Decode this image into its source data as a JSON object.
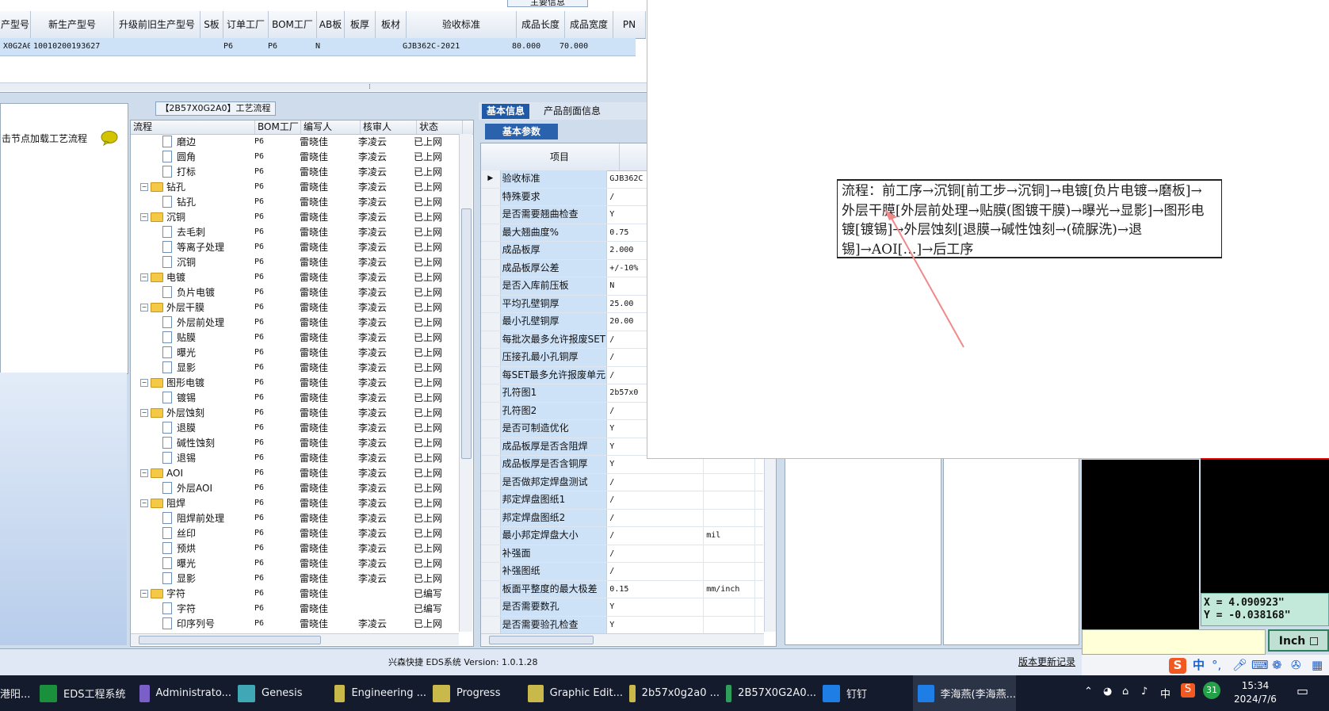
{
  "top_grid": {
    "group_caption": "主要信息",
    "columns": [
      "产型号",
      "新生产型号",
      "升级前旧生产型号",
      "S板",
      "订单工厂",
      "BOM工厂",
      "AB板",
      "板厚",
      "板材",
      "验收标准",
      "成品长度",
      "成品宽度",
      "PN"
    ],
    "row": [
      "X0G2A0",
      "10010200193627",
      "",
      "",
      "P6",
      "P6",
      "N",
      "",
      "",
      "GJB362C-2021",
      "80.000",
      "70.000",
      ""
    ]
  },
  "left_panel": {
    "hint": "击节点加载工艺流程"
  },
  "process_tree": {
    "caption": "【2B57X0G2A0】工艺流程",
    "columns": [
      "流程",
      "BOM工厂",
      "编写人",
      "核审人",
      "状态"
    ],
    "rows": [
      {
        "name": "磨边",
        "level": 2,
        "type": "doc",
        "bom": "P6",
        "writer": "雷晓佳",
        "reviewer": "李凌云",
        "status": "已上网"
      },
      {
        "name": "圆角",
        "level": 2,
        "type": "doc",
        "bom": "P6",
        "writer": "雷晓佳",
        "reviewer": "李凌云",
        "status": "已上网"
      },
      {
        "name": "打标",
        "level": 2,
        "type": "doc",
        "bom": "P6",
        "writer": "雷晓佳",
        "reviewer": "李凌云",
        "status": "已上网"
      },
      {
        "name": "钻孔",
        "level": 1,
        "type": "folder",
        "bom": "P6",
        "writer": "雷晓佳",
        "reviewer": "李凌云",
        "status": "已上网"
      },
      {
        "name": "钻孔",
        "level": 2,
        "type": "doc",
        "bom": "P6",
        "writer": "雷晓佳",
        "reviewer": "李凌云",
        "status": "已上网"
      },
      {
        "name": "沉铜",
        "level": 1,
        "type": "folder",
        "bom": "P6",
        "writer": "雷晓佳",
        "reviewer": "李凌云",
        "status": "已上网"
      },
      {
        "name": "去毛刺",
        "level": 2,
        "type": "doc",
        "bom": "P6",
        "writer": "雷晓佳",
        "reviewer": "李凌云",
        "status": "已上网"
      },
      {
        "name": "等离子处理",
        "level": 2,
        "type": "doc",
        "bom": "P6",
        "writer": "雷晓佳",
        "reviewer": "李凌云",
        "status": "已上网"
      },
      {
        "name": "沉铜",
        "level": 2,
        "type": "doc",
        "bom": "P6",
        "writer": "雷晓佳",
        "reviewer": "李凌云",
        "status": "已上网"
      },
      {
        "name": "电镀",
        "level": 1,
        "type": "folder",
        "bom": "P6",
        "writer": "雷晓佳",
        "reviewer": "李凌云",
        "status": "已上网"
      },
      {
        "name": "负片电镀",
        "level": 2,
        "type": "doc",
        "bom": "P6",
        "writer": "雷晓佳",
        "reviewer": "李凌云",
        "status": "已上网"
      },
      {
        "name": "外层干膜",
        "level": 1,
        "type": "folder",
        "bom": "P6",
        "writer": "雷晓佳",
        "reviewer": "李凌云",
        "status": "已上网"
      },
      {
        "name": "外层前处理",
        "level": 2,
        "type": "doc",
        "bom": "P6",
        "writer": "雷晓佳",
        "reviewer": "李凌云",
        "status": "已上网"
      },
      {
        "name": "贴膜",
        "level": 2,
        "type": "doc",
        "bom": "P6",
        "writer": "雷晓佳",
        "reviewer": "李凌云",
        "status": "已上网"
      },
      {
        "name": "曝光",
        "level": 2,
        "type": "doc",
        "bom": "P6",
        "writer": "雷晓佳",
        "reviewer": "李凌云",
        "status": "已上网"
      },
      {
        "name": "显影",
        "level": 2,
        "type": "doc",
        "bom": "P6",
        "writer": "雷晓佳",
        "reviewer": "李凌云",
        "status": "已上网"
      },
      {
        "name": "图形电镀",
        "level": 1,
        "type": "folder",
        "bom": "P6",
        "writer": "雷晓佳",
        "reviewer": "李凌云",
        "status": "已上网"
      },
      {
        "name": "镀锡",
        "level": 2,
        "type": "doc",
        "bom": "P6",
        "writer": "雷晓佳",
        "reviewer": "李凌云",
        "status": "已上网"
      },
      {
        "name": "外层蚀刻",
        "level": 1,
        "type": "folder",
        "bom": "P6",
        "writer": "雷晓佳",
        "reviewer": "李凌云",
        "status": "已上网"
      },
      {
        "name": "退膜",
        "level": 2,
        "type": "doc",
        "bom": "P6",
        "writer": "雷晓佳",
        "reviewer": "李凌云",
        "status": "已上网"
      },
      {
        "name": "碱性蚀刻",
        "level": 2,
        "type": "doc",
        "bom": "P6",
        "writer": "雷晓佳",
        "reviewer": "李凌云",
        "status": "已上网"
      },
      {
        "name": "退锡",
        "level": 2,
        "type": "doc",
        "bom": "P6",
        "writer": "雷晓佳",
        "reviewer": "李凌云",
        "status": "已上网"
      },
      {
        "name": "AOI",
        "level": 1,
        "type": "folder",
        "bom": "P6",
        "writer": "雷晓佳",
        "reviewer": "李凌云",
        "status": "已上网"
      },
      {
        "name": "外层AOI",
        "level": 2,
        "type": "doc",
        "bom": "P6",
        "writer": "雷晓佳",
        "reviewer": "李凌云",
        "status": "已上网"
      },
      {
        "name": "阻焊",
        "level": 1,
        "type": "folder",
        "bom": "P6",
        "writer": "雷晓佳",
        "reviewer": "李凌云",
        "status": "已上网"
      },
      {
        "name": "阻焊前处理",
        "level": 2,
        "type": "doc",
        "bom": "P6",
        "writer": "雷晓佳",
        "reviewer": "李凌云",
        "status": "已上网"
      },
      {
        "name": "丝印",
        "level": 2,
        "type": "doc",
        "bom": "P6",
        "writer": "雷晓佳",
        "reviewer": "李凌云",
        "status": "已上网"
      },
      {
        "name": "预烘",
        "level": 2,
        "type": "doc",
        "bom": "P6",
        "writer": "雷晓佳",
        "reviewer": "李凌云",
        "status": "已上网"
      },
      {
        "name": "曝光",
        "level": 2,
        "type": "doc",
        "bom": "P6",
        "writer": "雷晓佳",
        "reviewer": "李凌云",
        "status": "已上网"
      },
      {
        "name": "显影",
        "level": 2,
        "type": "doc",
        "bom": "P6",
        "writer": "雷晓佳",
        "reviewer": "李凌云",
        "status": "已上网"
      },
      {
        "name": "字符",
        "level": 1,
        "type": "folder",
        "bom": "P6",
        "writer": "雷晓佳",
        "reviewer": "",
        "status": "已编写"
      },
      {
        "name": "字符",
        "level": 2,
        "type": "doc",
        "bom": "P6",
        "writer": "雷晓佳",
        "reviewer": "",
        "status": "已编写"
      },
      {
        "name": "印序列号",
        "level": 2,
        "type": "doc",
        "bom": "P6",
        "writer": "雷晓佳",
        "reviewer": "李凌云",
        "status": "已上网"
      }
    ]
  },
  "props": {
    "tabs": [
      "基本信息",
      "产品剖面信息"
    ],
    "subtab": "基本参数",
    "header": "项目",
    "rows": [
      {
        "label": "验收标准",
        "value": "GJB362C",
        "unit": "",
        "current": true
      },
      {
        "label": "特殊要求",
        "value": "/",
        "unit": ""
      },
      {
        "label": "是否需要翘曲检查",
        "value": "Y",
        "unit": ""
      },
      {
        "label": "最大翘曲度%",
        "value": "0.75",
        "unit": ""
      },
      {
        "label": "成品板厚",
        "value": "2.000",
        "unit": ""
      },
      {
        "label": "成品板厚公差",
        "value": "+/-10%",
        "unit": ""
      },
      {
        "label": "是否入库前压板",
        "value": "N",
        "unit": ""
      },
      {
        "label": "平均孔壁铜厚",
        "value": "25.00",
        "unit": ""
      },
      {
        "label": "最小孔壁铜厚",
        "value": "20.00",
        "unit": ""
      },
      {
        "label": "每批次最多允许报废SET",
        "value": "/",
        "unit": ""
      },
      {
        "label": "压接孔最小孔铜厚",
        "value": "/",
        "unit": ""
      },
      {
        "label": "每SET最多允许报废单元",
        "value": "/",
        "unit": ""
      },
      {
        "label": "孔符图1",
        "value": "2b57x0",
        "unit": ""
      },
      {
        "label": "孔符图2",
        "value": "/",
        "unit": ""
      },
      {
        "label": "是否可制造优化",
        "value": "Y",
        "unit": ""
      },
      {
        "label": "成品板厚是否含阻焊",
        "value": "Y",
        "unit": ""
      },
      {
        "label": "成品板厚是否含铜厚",
        "value": "Y",
        "unit": ""
      },
      {
        "label": "是否做邦定焊盘测试",
        "value": "/",
        "unit": ""
      },
      {
        "label": "邦定焊盘图纸1",
        "value": "/",
        "unit": ""
      },
      {
        "label": "邦定焊盘图纸2",
        "value": "/",
        "unit": ""
      },
      {
        "label": "最小邦定焊盘大小",
        "value": "/",
        "unit": "mil"
      },
      {
        "label": "补强面",
        "value": "/",
        "unit": ""
      },
      {
        "label": "补强图纸",
        "value": "/",
        "unit": ""
      },
      {
        "label": "板面平整度的最大极差",
        "value": "0.15",
        "unit": "mm/inch"
      },
      {
        "label": "是否需要数孔",
        "value": "Y",
        "unit": ""
      },
      {
        "label": "是否需要验孔检查",
        "value": "Y",
        "unit": ""
      }
    ]
  },
  "popup": {
    "flow_text": "流程：前工序→沉铜[前工步→沉铜]→电镀[负片电镀→磨板]→外层干膜[外层前处理→贴膜(图镀干膜)→曝光→显影]→图形电镀[镀锡]→外层蚀刻[退膜→碱性蚀刻→(硫脲洗)→退锡]→AOI[…]→后工序"
  },
  "cad": {
    "coord_x": "X = 4.090923\"",
    "coord_y": "Y = -0.038168\"",
    "unit": "Inch"
  },
  "status_bar": {
    "text": "兴森快捷  EDS系统  Version: 1.0.1.28",
    "changelog": "版本更新记录"
  },
  "ime": {
    "lang": "中"
  },
  "taskbar": {
    "items": [
      {
        "label": "EDS工程系统",
        "color": "#1a8f3c"
      },
      {
        "label": "Administrato...",
        "color": "#7a5fc8"
      },
      {
        "label": "Genesis",
        "color": "#3fa7b5"
      },
      {
        "label": "Engineering ...",
        "color": "#c9b84a"
      },
      {
        "label": "Progress",
        "color": "#c9b84a"
      },
      {
        "label": "Graphic Edit...",
        "color": "#c9b84a"
      },
      {
        "label": "2b57x0g2a0 ...",
        "color": "#c9b84a"
      },
      {
        "label": "2B57X0G2A0...",
        "color": "#2f9e5b"
      },
      {
        "label": "钉钉",
        "color": "#1f7ee6"
      },
      {
        "label": "李海燕(李海燕...",
        "color": "#1f7ee6"
      }
    ],
    "partial_label": "港阳...",
    "clock_time": "15:34",
    "clock_date": "2024/7/6",
    "tray_lang": "中",
    "tray_badge": "31"
  },
  "colors": {
    "accent": "#1e5aa8",
    "selected_row": "#cde1f7",
    "taskbar": "#141b2d",
    "cad_bg": "#000000",
    "annotation_arrow": "#f08a8a"
  }
}
